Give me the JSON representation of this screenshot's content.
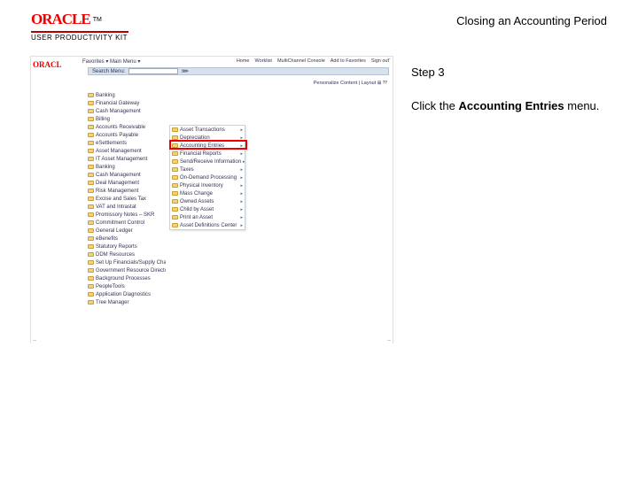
{
  "header": {
    "brand": "ORACLE",
    "tm": "TM",
    "kit": "USER PRODUCTIVITY KIT",
    "title": "Closing an Accounting Period"
  },
  "instructions": {
    "step_label": "Step 3",
    "text_pre": "Click the ",
    "text_bold": "Accounting Entries",
    "text_post": " menu."
  },
  "screenshot": {
    "logo": "ORACL",
    "favorites": "Favorites ▾    Main Menu ▾",
    "topnav": [
      "Home",
      "Worklist",
      "MultiChannel Console",
      "Add to Favorites",
      "Sign out"
    ],
    "search_label": "Search Menu:",
    "go": "⋙",
    "personalize": "Personalize Content | Layout   ⊞ ⁇",
    "nav": [
      "Banking",
      "Financial Gateway",
      "Cash Management",
      "Billing",
      "Accounts Receivable",
      "Accounts Payable",
      "eSettlements",
      "Asset Management",
      "IT Asset Management",
      "Banking",
      "Cash Management",
      "Deal Management",
      "Risk Management",
      "Excise and Sales Tax",
      "VAT and Intrastat",
      "Promissory Notes – SKR",
      "Commitment Control",
      "General Ledger",
      "eBenefits",
      "Statutory Reports",
      "DDM Resources",
      "Set Up Financials/Supply Chain",
      "Government Resource Directory",
      "Background Processes",
      "PeopleTools",
      "Application Diagnostics",
      "Tree Manager"
    ],
    "submenu": [
      "Asset Transactions",
      "Depreciation",
      "Accounting Entries",
      "Financial Reports",
      "Send/Receive Information",
      "Taxes",
      "On-Demand Processing",
      "Physical Inventory",
      "Mass Change",
      "Owned Assets",
      "Child by Asset",
      "Print an Asset",
      "Asset Definitions Center"
    ],
    "highlight_index": 2
  }
}
